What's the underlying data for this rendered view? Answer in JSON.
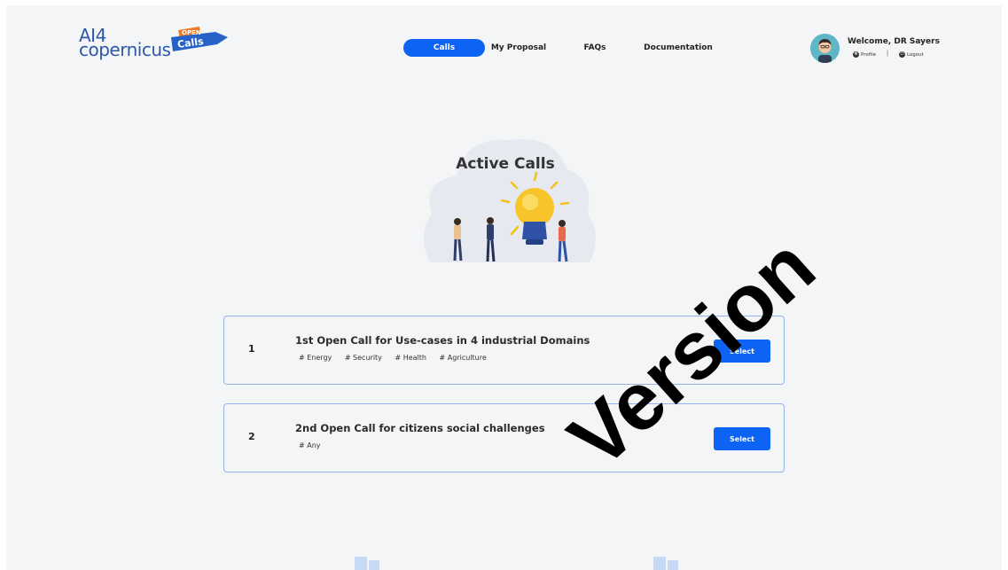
{
  "brand": {
    "line1": "AI4",
    "line2": "copernicus",
    "badge_top": "OPEN",
    "badge_bottom": "Calls",
    "color": "#2e57a8",
    "badge_colors": [
      "#f07a2a",
      "#2563c8"
    ]
  },
  "nav": {
    "items": [
      {
        "label": "Calls",
        "active": true
      },
      {
        "label": "My Proposal",
        "active": false
      },
      {
        "label": "FAQs",
        "active": false
      },
      {
        "label": "Documentation",
        "active": false
      }
    ],
    "active_color": "#0d63f3"
  },
  "user": {
    "welcome": "Welcome, DR Sayers",
    "profile_label": "Profile",
    "profile_icon": "gear-icon",
    "logout_label": "Logout",
    "logout_icon": "power-icon",
    "separator": "|"
  },
  "hero": {
    "title": "Active Calls"
  },
  "calls": [
    {
      "number": "1",
      "title": "1st Open Call for Use-cases in 4 industrial Domains",
      "tags": [
        "# Energy",
        "# Security",
        "# Health",
        "# Agriculture"
      ],
      "button": "Select"
    },
    {
      "number": "2",
      "title": "2nd Open Call for citizens social challenges",
      "tags": [
        "# Any"
      ],
      "button": "Select"
    }
  ],
  "watermark": "Version"
}
